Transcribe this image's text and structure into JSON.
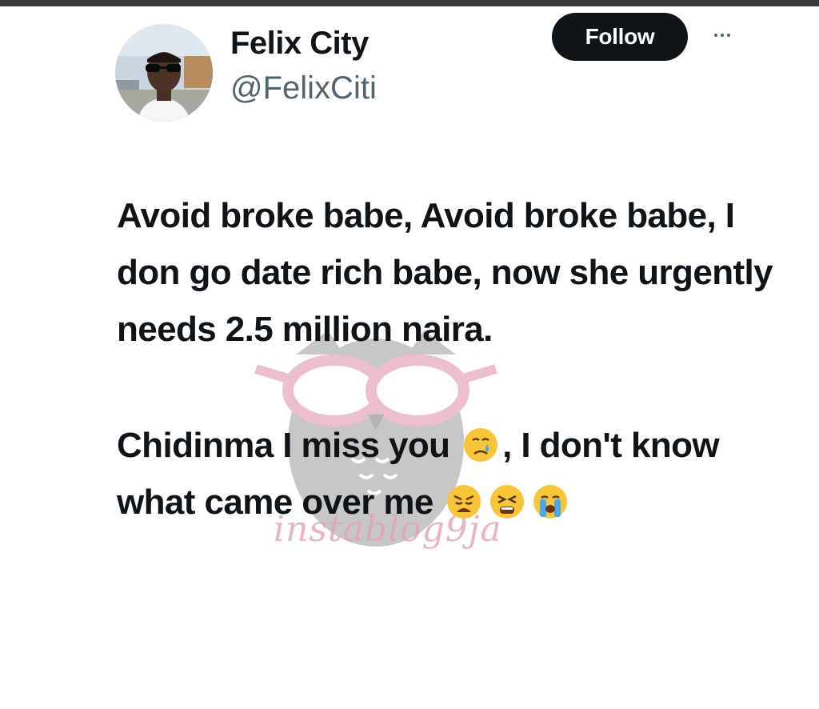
{
  "author": {
    "display_name": "Felix City",
    "handle": "@FelixCiti"
  },
  "actions": {
    "follow_label": "Follow",
    "more_icon": "more-horizontal-icon"
  },
  "tweet": {
    "paragraph_1": "Avoid broke babe, Avoid broke babe, I don go date rich babe, now she urgently needs 2.5 million naira.",
    "paragraph_2_a": "Chidinma I miss you",
    "paragraph_2_b": ", I don't know what came over me",
    "emojis": [
      "crying-face-icon",
      "weary-face-icon",
      "tired-face-icon",
      "loudly-crying-face-icon"
    ]
  },
  "watermark": {
    "text": "instablog9ja",
    "icon": "owl-logo-icon"
  },
  "colors": {
    "follow_bg": "#0f1419",
    "text": "#0f1419",
    "secondary": "#536471",
    "watermark_pink": "#e3a2b8"
  }
}
